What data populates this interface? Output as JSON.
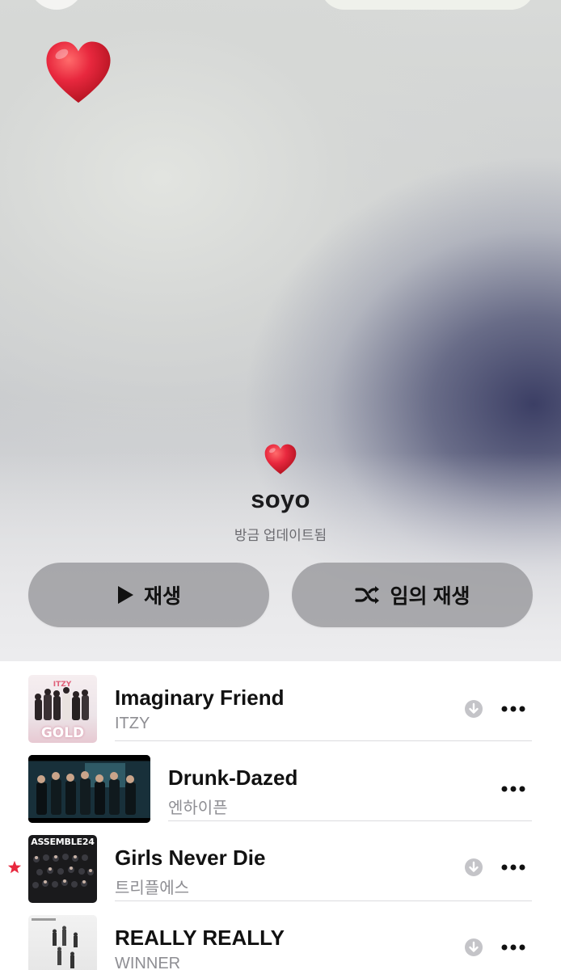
{
  "playlist": {
    "title": "soyo",
    "subtitle": "방금 업데이트됨"
  },
  "actions": {
    "play_label": "재생",
    "shuffle_label": "임의 재생"
  },
  "tracks": [
    {
      "title": "Imaginary Friend",
      "artist": "ITZY",
      "downloadable": true,
      "favorite": false,
      "artwork_text": "GOLD"
    },
    {
      "title": "Drunk-Dazed",
      "artist": "엔하이픈",
      "downloadable": false,
      "favorite": false,
      "video": true
    },
    {
      "title": "Girls Never Die",
      "artist": "트리플에스",
      "downloadable": true,
      "favorite": true,
      "artwork_text": "ASSEMBLE24"
    },
    {
      "title": "REALLY REALLY",
      "artist": "WINNER",
      "downloadable": true,
      "favorite": false
    }
  ],
  "icons": {
    "hero": "red-heart-emoji",
    "play": "play-icon",
    "shuffle": "shuffle-icon",
    "download": "download-icon",
    "more": "ellipsis-icon",
    "favorite": "star-icon"
  },
  "colors": {
    "accent": "#e8283e",
    "button_bg": "#96969a",
    "secondary_text": "#8e8e93"
  }
}
